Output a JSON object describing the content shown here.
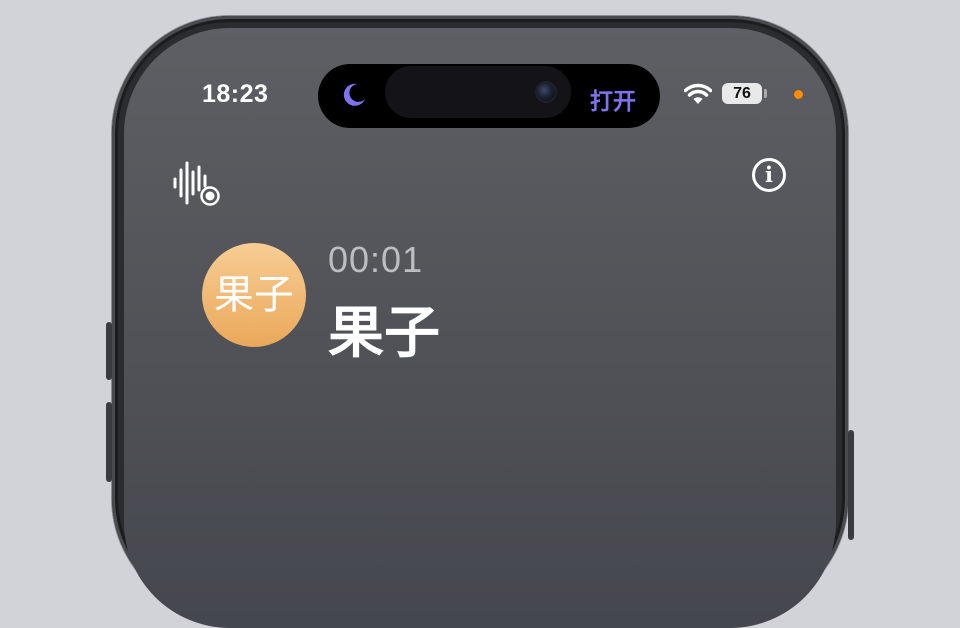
{
  "status_bar": {
    "time": "18:23",
    "battery_level": "76",
    "wifi_icon": "wifi-icon",
    "indicator_color": "#ff8c00"
  },
  "dynamic_island": {
    "mode_icon": "moon-icon",
    "action_label": "打开",
    "accent_color": "#7e74f0"
  },
  "call": {
    "duration": "00:01",
    "caller_name": "果子",
    "avatar_text": "果子",
    "avatar_colors": [
      "#f7cd94",
      "#eaa85a"
    ]
  },
  "toolbar": {
    "left_icon": "audio-waveform-record-icon",
    "right_icon": "info-icon"
  }
}
